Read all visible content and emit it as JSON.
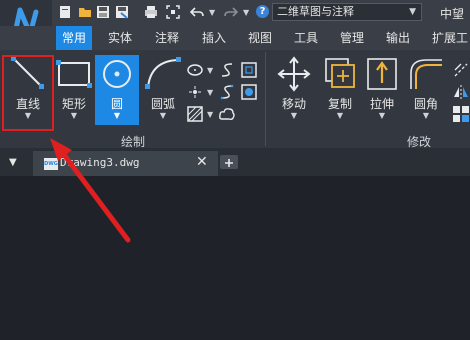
{
  "quick_access": {
    "icons": [
      "new-file-icon",
      "open-folder-icon",
      "save-icon",
      "save-as-icon",
      "print-icon",
      "zoom-extents-icon",
      "undo-icon",
      "redo-icon",
      "help-icon"
    ],
    "workspace_selected": "二维草图与注释",
    "app_title_fragment": "中望"
  },
  "ribbon_tabs": [
    {
      "label": "常用",
      "active": true
    },
    {
      "label": "实体"
    },
    {
      "label": "注释"
    },
    {
      "label": "插入"
    },
    {
      "label": "视图"
    },
    {
      "label": "工具"
    },
    {
      "label": "管理"
    },
    {
      "label": "输出"
    },
    {
      "label": "扩展工"
    }
  ],
  "groups": {
    "draw": {
      "label": "绘制",
      "buttons": [
        {
          "label": "直线",
          "icon": "line-icon"
        },
        {
          "label": "矩形",
          "icon": "rectangle-icon"
        },
        {
          "label": "圆",
          "icon": "circle-icon"
        },
        {
          "label": "圆弧",
          "icon": "arc-icon"
        }
      ],
      "small_tools": [
        "ellipse-icon",
        "spline-icon",
        "polyline-icon",
        "hatch-icon",
        "revcloud-icon",
        "region-icon"
      ]
    },
    "modify": {
      "label": "修改",
      "buttons": [
        {
          "label": "移动",
          "icon": "move-icon"
        },
        {
          "label": "复制",
          "icon": "copy-icon"
        },
        {
          "label": "拉伸",
          "icon": "stretch-icon"
        },
        {
          "label": "圆角",
          "icon": "fillet-icon"
        }
      ]
    }
  },
  "document": {
    "tab_name": "Drawing3.dwg",
    "badge": "DWG"
  },
  "colors": {
    "accent": "#1e88e5",
    "highlight_border": "#e02020",
    "annotation_arrow": "#e02020"
  }
}
